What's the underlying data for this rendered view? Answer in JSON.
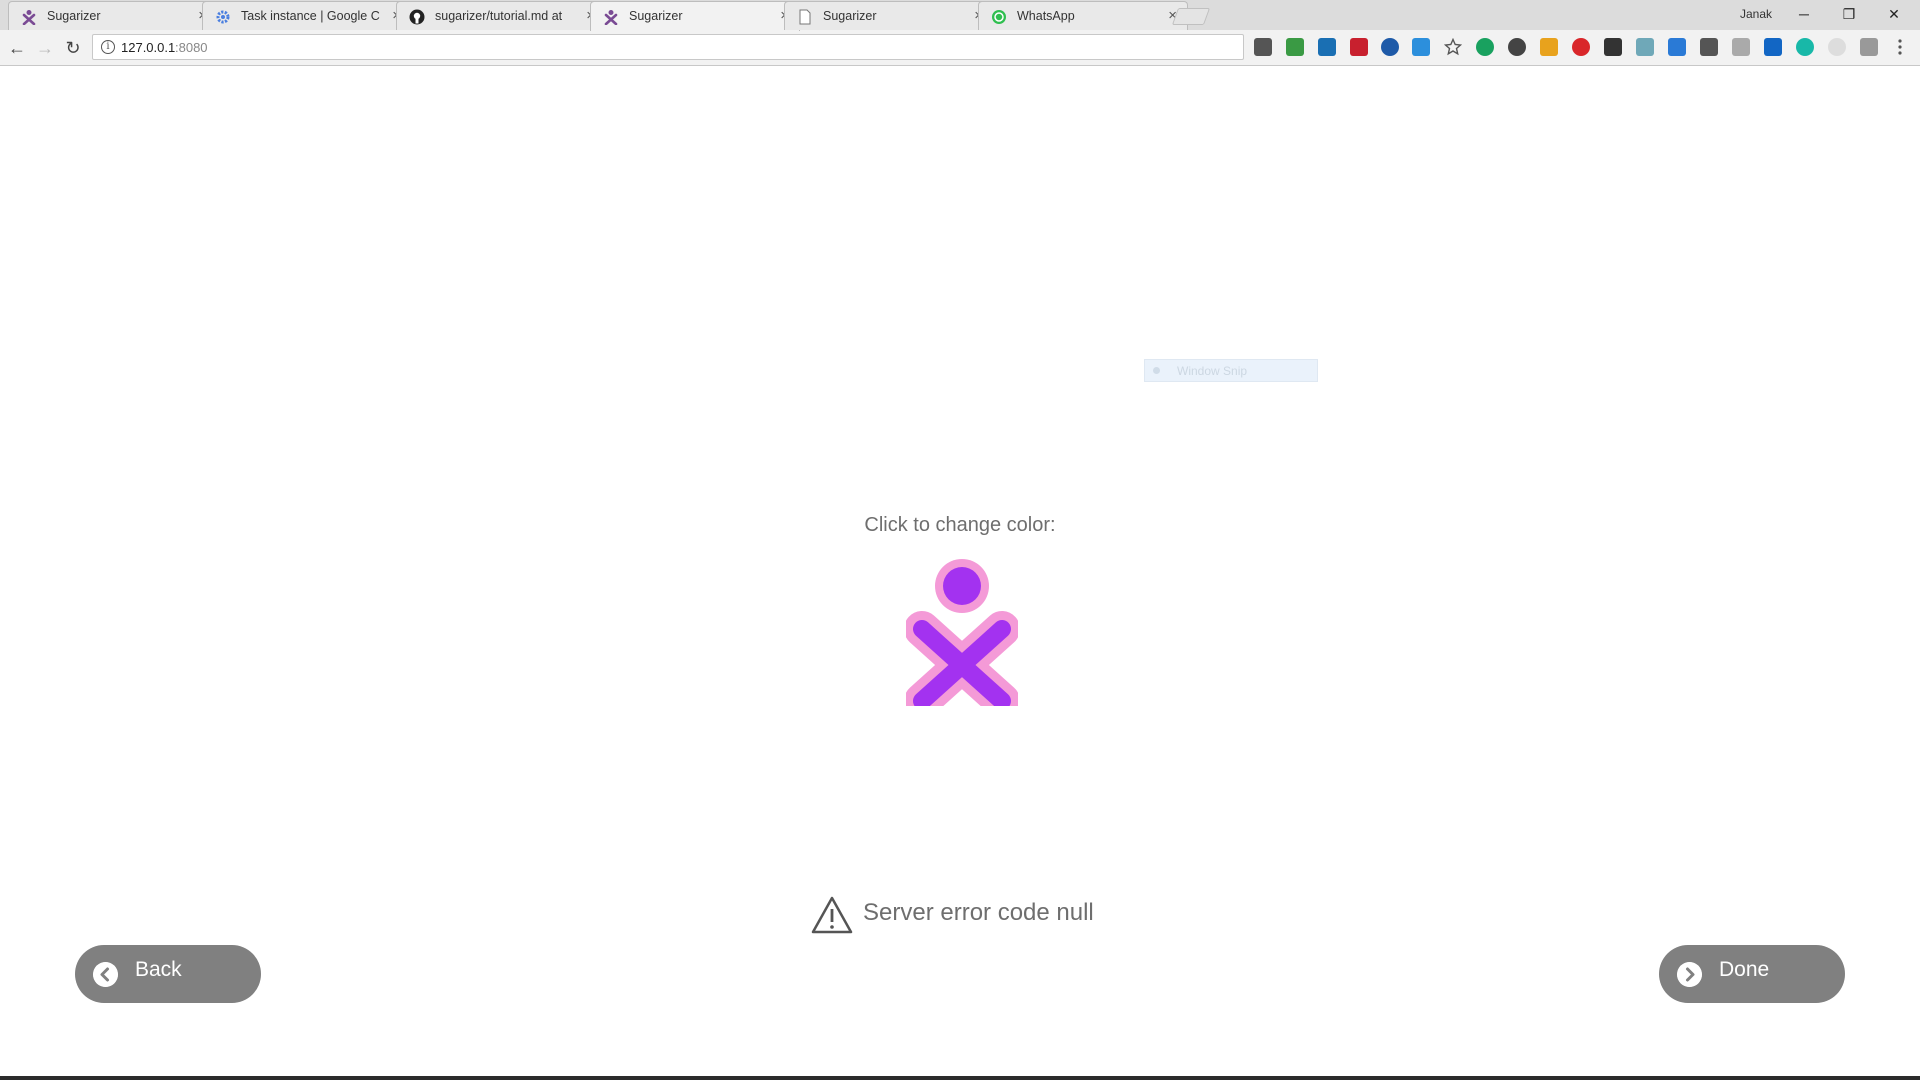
{
  "browser": {
    "tabs": [
      {
        "title": "Sugarizer",
        "icon": "sugarizer-icon"
      },
      {
        "title": "Task instance | Google C",
        "icon": "gear-icon"
      },
      {
        "title": "sugarizer/tutorial.md at",
        "icon": "github-icon"
      },
      {
        "title": "Sugarizer",
        "icon": "sugarizer-icon",
        "active": true
      },
      {
        "title": "Sugarizer",
        "icon": "page-icon"
      },
      {
        "title": "WhatsApp",
        "icon": "whatsapp-icon"
      }
    ],
    "profile_name": "Janak",
    "close_glyph": "×",
    "address": {
      "host": "127.0.0.1",
      "port": ":8080"
    },
    "window_controls": {
      "minimize": "─",
      "restore": "❐",
      "close": "✕"
    },
    "nav": {
      "back": "←",
      "forward": "→",
      "reload": "↻"
    }
  },
  "overlay": {
    "window_snip": "Window Snip"
  },
  "page": {
    "color_label": "Click to change color:",
    "xo_colors": {
      "stroke": "#f49ad7",
      "fill": "#a332f0"
    },
    "error_message": "Server error code null",
    "back_label": "Back",
    "done_label": "Done"
  }
}
